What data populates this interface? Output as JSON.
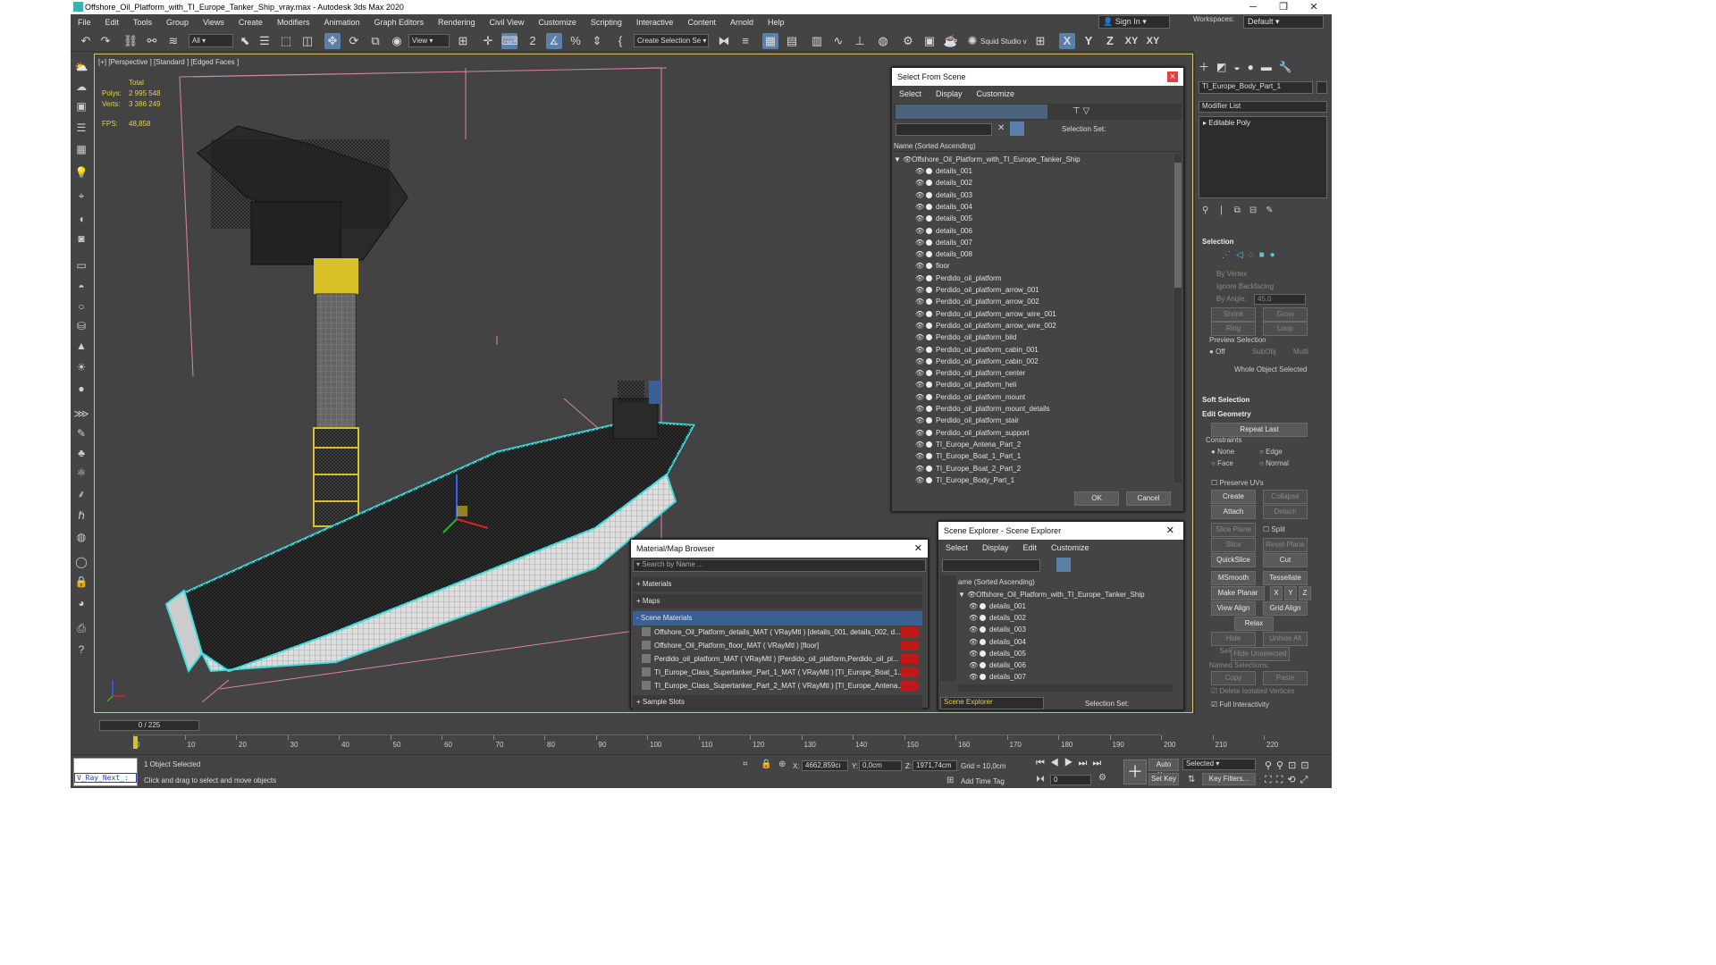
{
  "window": {
    "title": "Offshore_Oil_Platform_with_TI_Europe_Tanker_Ship_vray.max - Autodesk 3ds Max 2020",
    "controls": [
      "─",
      "❐",
      "✕"
    ]
  },
  "menu": [
    "File",
    "Edit",
    "Tools",
    "Group",
    "Views",
    "Create",
    "Modifiers",
    "Animation",
    "Graph Editors",
    "Rendering",
    "Civil View",
    "Customize",
    "Scripting",
    "Interactive",
    "Content",
    "Arnold",
    "Help"
  ],
  "account": {
    "sign_in": "Sign In",
    "workspaces_label": "Workspaces:",
    "workspace": "Default"
  },
  "toolbar": {
    "filter": "All",
    "ref_coord": "View",
    "selection_set": "Create Selection Se",
    "squid": "Squid Studio v",
    "axis": [
      "X",
      "Y",
      "Z",
      "XY",
      "XY"
    ]
  },
  "viewport": {
    "label": "[+] [Perspective ] [Standard ] [Edged Faces ]",
    "stats": {
      "total": "Total",
      "polys_label": "Polys:",
      "polys": "2 995 548",
      "verts_label": "Verts:",
      "verts": "3 386 249",
      "fps_label": "FPS:",
      "fps": "48,858"
    }
  },
  "select_from_scene": {
    "title": "Select From Scene",
    "menu": [
      "Select",
      "Display",
      "Customize"
    ],
    "selection_set_label": "Selection Set:",
    "column_header": "Name (Sorted Ascending)",
    "root": "Offshore_Oil_Platform_with_TI_Europe_Tanker_Ship",
    "items": [
      "details_001",
      "details_002",
      "details_003",
      "details_004",
      "details_005",
      "details_006",
      "details_007",
      "details_008",
      "floor",
      "Perdido_oil_platform",
      "Perdido_oil_platform_arrow_001",
      "Perdido_oil_platform_arrow_002",
      "Perdido_oil_platform_arrow_wire_001",
      "Perdido_oil_platform_arrow_wire_002",
      "Perdido_oil_platform_bild",
      "Perdido_oil_platform_cabin_001",
      "Perdido_oil_platform_cabin_002",
      "Perdido_oil_platform_center",
      "Perdido_oil_platform_heli",
      "Perdido_oil_platform_mount",
      "Perdido_oil_platform_mount_details",
      "Perdido_oil_platform_stair",
      "Perdido_oil_platform_support",
      "TI_Europe_Antena_Part_2",
      "TI_Europe_Boat_1_Part_1",
      "TI_Europe_Boat_2_Part_2",
      "TI_Europe_Body_Part_1"
    ],
    "ok": "OK",
    "cancel": "Cancel"
  },
  "material_browser": {
    "title": "Material/Map Browser",
    "search_placeholder": "Search by Name ...",
    "categories": [
      "+ Materials",
      "+ Maps",
      "- Scene Materials",
      "+ Sample Slots"
    ],
    "materials": [
      "Offshore_Oil_Platform_details_MAT ( VRayMtl ) [details_001, details_002, d...",
      "Offshore_Oil_Platform_floor_MAT ( VRayMtl ) [floor]",
      "Perdido_oil_platform_MAT ( VRayMtl ) [Perdido_oil_platform,Perdido_oil_pl...",
      "TI_Europe_Class_Supertanker_Part_1_MAT ( VRayMtl ) [TI_Europe_Boat_1...",
      "TI_Europe_Class_Supertanker_Part_2_MAT ( VRayMtl ) [TI_Europe_Antena..."
    ]
  },
  "scene_explorer": {
    "title": "Scene Explorer - Scene Explorer",
    "menu": [
      "Select",
      "Display",
      "Edit",
      "Customize"
    ],
    "column_header": "ame (Sorted Ascending)",
    "root": "Offshore_Oil_Platform_with_TI_Europe_Tanker_Ship",
    "items": [
      "details_001",
      "details_002",
      "details_003",
      "details_004",
      "details_005",
      "details_006",
      "details_007"
    ],
    "footer_name": "Scene Explorer",
    "selection_set_label": "Selection Set:"
  },
  "command_panel": {
    "object_name": "TI_Europe_Body_Part_1",
    "modifier_list": "Modifier List",
    "stack_item": "Editable Poly",
    "selection": {
      "title": "Selection",
      "by_vertex": "By Vertex",
      "ignore_backfacing": "Ignore Backfacing",
      "by_angle": "By Angle:",
      "angle": "45,0",
      "shrink": "Shrink",
      "grow": "Grow",
      "ring": "Ring",
      "loop": "Loop",
      "preview_selection": "Preview Selection",
      "preview_opts": [
        "Off",
        "SubObj",
        "Multi"
      ],
      "whole_object": "Whole Object Selected"
    },
    "soft_selection": "Soft Selection",
    "edit_geometry": {
      "title": "Edit Geometry",
      "repeat_last": "Repeat Last",
      "constraints": "Constraints",
      "constraint_opts": [
        "None",
        "Edge",
        "Face",
        "Normal"
      ],
      "preserve_uvs": "Preserve UVs",
      "create": "Create",
      "collapse": "Collapse",
      "attach": "Attach",
      "detach": "Detach",
      "slice_plane": "Slice Plane",
      "split": "Split",
      "slice": "Slice",
      "reset_plane": "Reset Plane",
      "quickslice": "QuickSlice",
      "cut": "Cut",
      "msmooth": "MSmooth",
      "tessellate": "Tessellate",
      "make_planar": "Make Planar",
      "xyz": [
        "X",
        "Y",
        "Z"
      ],
      "view_align": "View Align",
      "grid_align": "Grid Align",
      "relax": "Relax",
      "hide_selected": "Hide Selected",
      "unhide_all": "Unhide All",
      "hide_unselected": "Hide Unselected",
      "named_selections": "Named Selections:",
      "copy": "Copy",
      "paste": "Paste",
      "delete_isolated": "Delete Isolated Vertices",
      "full_interactivity": "Full Interactivity"
    }
  },
  "timeline": {
    "frame": "0 / 225",
    "ticks": [
      "0",
      "10",
      "20",
      "30",
      "40",
      "50",
      "60",
      "70",
      "80",
      "90",
      "100",
      "110",
      "120",
      "130",
      "140",
      "150",
      "160",
      "170",
      "180",
      "190",
      "200",
      "210",
      "220"
    ]
  },
  "status": {
    "script_listener": "V_Ray_Next_:",
    "selected": "1 Object Selected",
    "prompt": "Click and drag to select and move objects",
    "x_label": "X:",
    "x": "4662,859cı",
    "y_label": "Y:",
    "y": "0,0cm",
    "z_label": "Z:",
    "z": "1971,74cm",
    "grid": "Grid = 10,0cm",
    "add_time_tag": "Add Time Tag",
    "auto_key": "Auto Key",
    "set_key": "Set Key",
    "selected_dropdown": "Selected",
    "key_filters": "Key Filters...",
    "frame_field": "0"
  },
  "colors": {
    "accent": "#5a7fa8",
    "selection_outline": "#3fe0e0",
    "stats": "#e8d04a",
    "highlight_row": "#3a5f93"
  }
}
